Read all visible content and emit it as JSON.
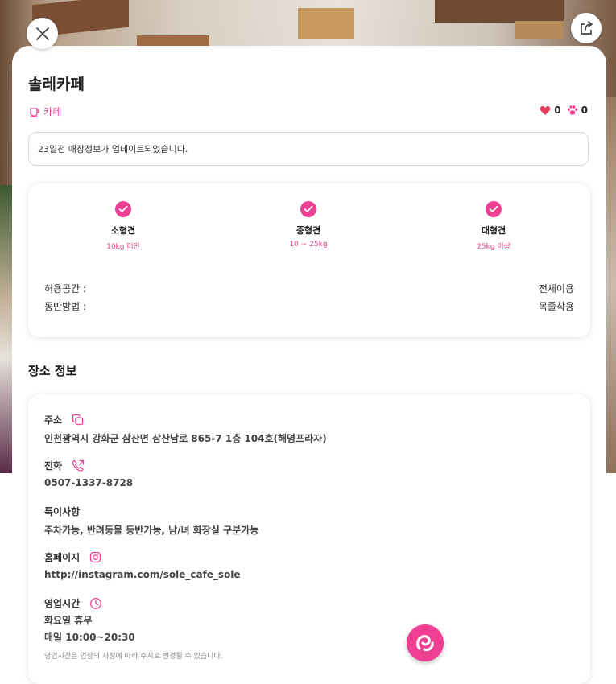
{
  "place": {
    "name": "솔레카페",
    "category": "카페",
    "like_count": "0",
    "paw_count": "0"
  },
  "notice": "23일전 매장정보가 업데이트되었습니다.",
  "dog_sizes": [
    {
      "name": "소형견",
      "range": "10kg 미만"
    },
    {
      "name": "중형견",
      "range": "10 ~ 25kg"
    },
    {
      "name": "대형견",
      "range": "25kg 이상"
    }
  ],
  "rules": [
    {
      "label": "허용공간 :",
      "value": "전체이용"
    },
    {
      "label": "동반방법 :",
      "value": "목줄착용"
    }
  ],
  "section_title": "장소 정보",
  "info": {
    "address_label": "주소",
    "address": "인천광역시 강화군 삼산면 삼산남로 865-7 1층 104호(해명프라자)",
    "phone_label": "전화",
    "phone": "0507-1337-8728",
    "notes_label": "특이사항",
    "notes": "주차가능, 반려동물 동반가능, 남/녀 화장실 구분가능",
    "homepage_label": "홈페이지",
    "homepage": "http://instagram.com/sole_cafe_sole",
    "hours_label": "영업시간",
    "hours_closed": "화요일 휴무",
    "hours_daily": "매일 10:00~20:30",
    "hours_note": "영업시간은 업장의 사정에 따라 수시로 변경될 수 있습니다."
  },
  "colors": {
    "accent": "#ef3f93",
    "accent_text": "#e8418e",
    "heart": "#e63c5a"
  },
  "icons": {
    "close": "close-icon",
    "share": "share-icon",
    "category": "coffee-cup-icon",
    "like": "heart-icon",
    "paw": "paw-icon",
    "copy": "copy-icon",
    "phone": "phone-icon",
    "instagram": "instagram-icon",
    "clock": "clock-icon",
    "fab": "app-logo-icon"
  }
}
